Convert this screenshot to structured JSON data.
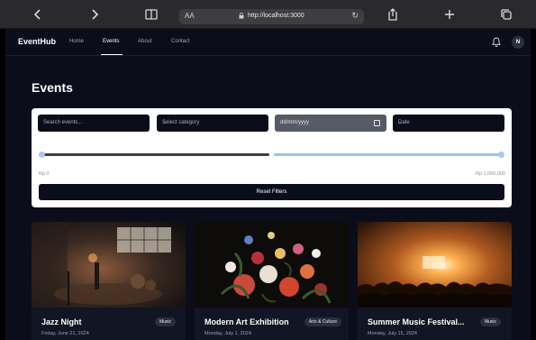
{
  "browser": {
    "reader_label": "AA",
    "url": "http://localhost:3000"
  },
  "nav": {
    "logo": "EventHub",
    "links": [
      "Home",
      "Events",
      "About",
      "Contact"
    ],
    "avatar_initial": "N"
  },
  "page": {
    "title": "Events"
  },
  "filters": {
    "search_placeholder": "Search events...",
    "category_placeholder": "Select category",
    "date_placeholder": "dd/mm/yyyy",
    "sort_label": "Date",
    "price_min_label": "Rp 0",
    "price_max_label": "Rp 1,000,000",
    "reset_label": "Reset Filters"
  },
  "events": [
    {
      "title": "Jazz Night",
      "date": "Friday, June 21, 2024",
      "category": "Music"
    },
    {
      "title": "Modern Art Exhibition",
      "date": "Monday, July 1, 2024",
      "category": "Arts & Culture"
    },
    {
      "title": "Summer Music Festival...",
      "date": "Monday, July 15, 2024",
      "category": "Music"
    }
  ],
  "colors": {
    "app_bg": "#0b0e1a",
    "card_bg": "#111524",
    "range_fill": "#9fc2ee"
  }
}
